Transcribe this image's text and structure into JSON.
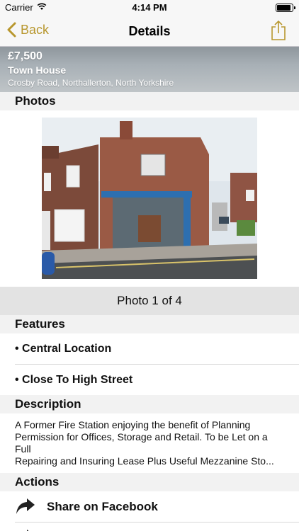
{
  "status_bar": {
    "carrier": "Carrier",
    "time": "4:14 PM"
  },
  "nav": {
    "back_label": "Back",
    "title": "Details"
  },
  "property": {
    "price": "£7,500",
    "type": "Town House",
    "address": "Crosby Road, Northallerton, North Yorkshire"
  },
  "sections": {
    "photos": "Photos",
    "features": "Features",
    "description": "Description",
    "actions": "Actions"
  },
  "photo_counter": "Photo 1 of 4",
  "features": [
    "• Central Location",
    "• Close To High Street"
  ],
  "description_lines": [
    "A Former Fire Station enjoying the benefit of Planning",
    "Permission for Offices, Storage and Retail. To be Let on a",
    "Full",
    "Repairing and Insuring Lease Plus Useful Mezzanine Sto..."
  ],
  "actions": [
    {
      "label": "Share on Facebook",
      "icon": "share-arrow-icon"
    }
  ],
  "colors": {
    "accent": "#b8972e",
    "section_bg": "#f2f2f2",
    "counter_bg": "#e3e3e3"
  }
}
